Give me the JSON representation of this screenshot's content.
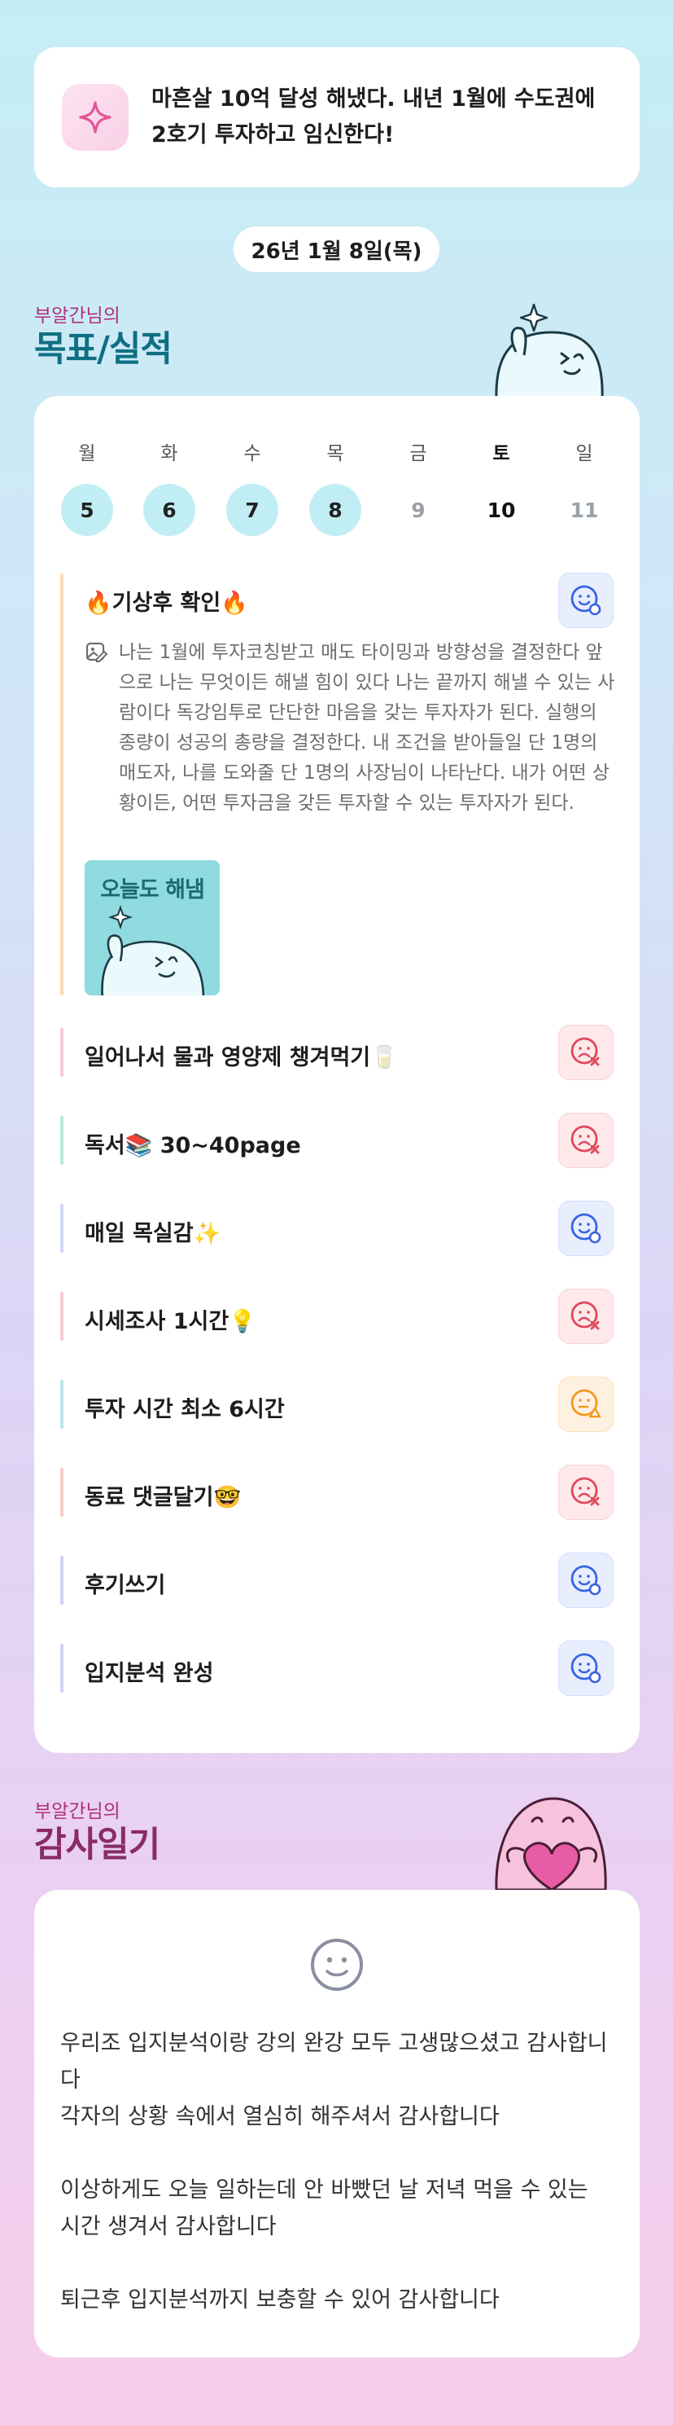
{
  "banner": {
    "icon": "sparkle-icon",
    "text": "마흔살 10억 달성 해냈다. 내년 1월에 수도권에 2호기 투자하고 임신한다!"
  },
  "date_label": "26년 1월 8일(목)",
  "goals_section": {
    "subtitle": "부알간님의",
    "title": "목표/실적"
  },
  "week": {
    "days": [
      {
        "weekday": "월",
        "date": "5",
        "state": "done"
      },
      {
        "weekday": "화",
        "date": "6",
        "state": "done"
      },
      {
        "weekday": "수",
        "date": "7",
        "state": "done"
      },
      {
        "weekday": "목",
        "date": "8",
        "state": "done"
      },
      {
        "weekday": "금",
        "date": "9",
        "state": "future"
      },
      {
        "weekday": "토",
        "date": "10",
        "state": "current"
      },
      {
        "weekday": "일",
        "date": "11",
        "state": "future"
      }
    ]
  },
  "goals": [
    {
      "title": "🔥기상후 확인🔥",
      "status": "done",
      "status_icon": "smile-check-icon",
      "bar_color": "#f9d9b5",
      "memo": "나는 1월에 투자코칭받고 매도 타이밍과 방향성을 결정한다 앞으로 나는 무엇이든 해낼 힘이 있다 나는 끝까지 해낼 수 있는 사람이다 독강임투로 단단한 마음을 갖는 투자자가 된다. 실행의 종량이 성공의 총량을 결정한다. 내 조건을 받아들일 단 1명의 매도자, 나를 도와줄 단 1명의 사장님이 나타난다. 내가 어떤 상황이든, 어떤 투자금을 갖든 투자할 수 있는 투자자가 된다.",
      "memo_icon": "memo-image-icon",
      "sticker_text": "오늘도 해냄"
    },
    {
      "title": "일어나서 물과 영양제 챙겨먹기🥛",
      "status": "failed",
      "status_icon": "sad-x-icon",
      "bar_color": "#f7c9dc"
    },
    {
      "title": "독서📚 30~40page",
      "status": "failed",
      "status_icon": "sad-x-icon",
      "bar_color": "#b7e7df"
    },
    {
      "title": "매일 목실감✨",
      "status": "done",
      "status_icon": "smile-check-icon",
      "bar_color": "#cfd6f5"
    },
    {
      "title": "시세조사 1시간💡",
      "status": "failed",
      "status_icon": "sad-x-icon",
      "bar_color": "#f7c9cf"
    },
    {
      "title": "투자 시간 최소 6시간",
      "status": "partial",
      "status_icon": "meh-triangle-icon",
      "bar_color": "#b8e4ec"
    },
    {
      "title": "동료 댓글달기🤓",
      "status": "failed",
      "status_icon": "sad-x-icon",
      "bar_color": "#f8ccc4"
    },
    {
      "title": "후기쓰기",
      "status": "done",
      "status_icon": "smile-check-icon",
      "bar_color": "#cfd3f2"
    },
    {
      "title": "입지분석 완성",
      "status": "done",
      "status_icon": "smile-check-icon",
      "bar_color": "#cfd3f2"
    }
  ],
  "gratitude_section": {
    "subtitle": "부알간님의",
    "title": "감사일기",
    "face_icon": "smiley-icon",
    "entries": [
      "우리조 입지분석이랑 강의 완강 모두 고생많으셨고 감사합니다",
      "각자의 상황 속에서 열심히 해주셔서 감사합니다",
      "",
      "이상하게도 오늘 일하는데 안 바빴던 날 저녁 먹을 수 있는 시간 생겨서 감사합니다",
      "",
      "퇴근후 입지분석까지 보충할 수 있어 감사합니다"
    ]
  },
  "colors": {
    "accent_pink": "#b0307a",
    "accent_teal": "#0f6f82",
    "accent_purple": "#8a2a66",
    "done_blue": "#3a63e0",
    "fail_red": "#e0475a",
    "partial_orange": "#f29a1f"
  }
}
